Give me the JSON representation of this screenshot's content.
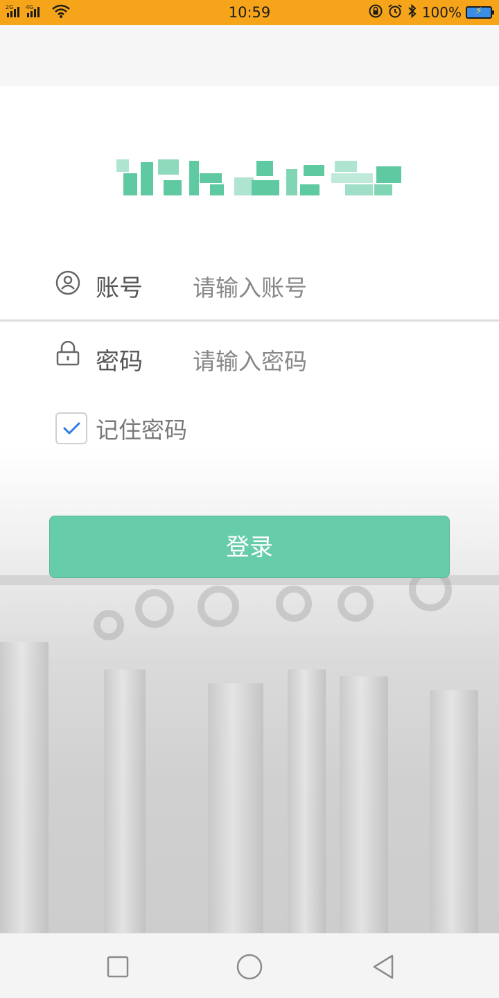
{
  "status_bar": {
    "network_left": "2G",
    "network_right": "4G",
    "time": "10:59",
    "battery_percent": "100%",
    "icons": [
      "signal-icon",
      "wifi-icon",
      "lock-rotation-icon",
      "alarm-icon",
      "bluetooth-icon",
      "battery-icon"
    ]
  },
  "form": {
    "account_label": "账号",
    "account_placeholder": "请输入账号",
    "password_label": "密码",
    "password_placeholder": "请输入密码",
    "remember_label": "记住密码",
    "remember_checked": true
  },
  "login_button": {
    "label": "登录"
  },
  "colors": {
    "status_bar": "#f6a51a",
    "accent": "#66ccaa",
    "checkbox_tick": "#2a7ce0"
  },
  "nav": {
    "icons": [
      "recent-apps-icon",
      "home-icon",
      "back-icon"
    ]
  }
}
